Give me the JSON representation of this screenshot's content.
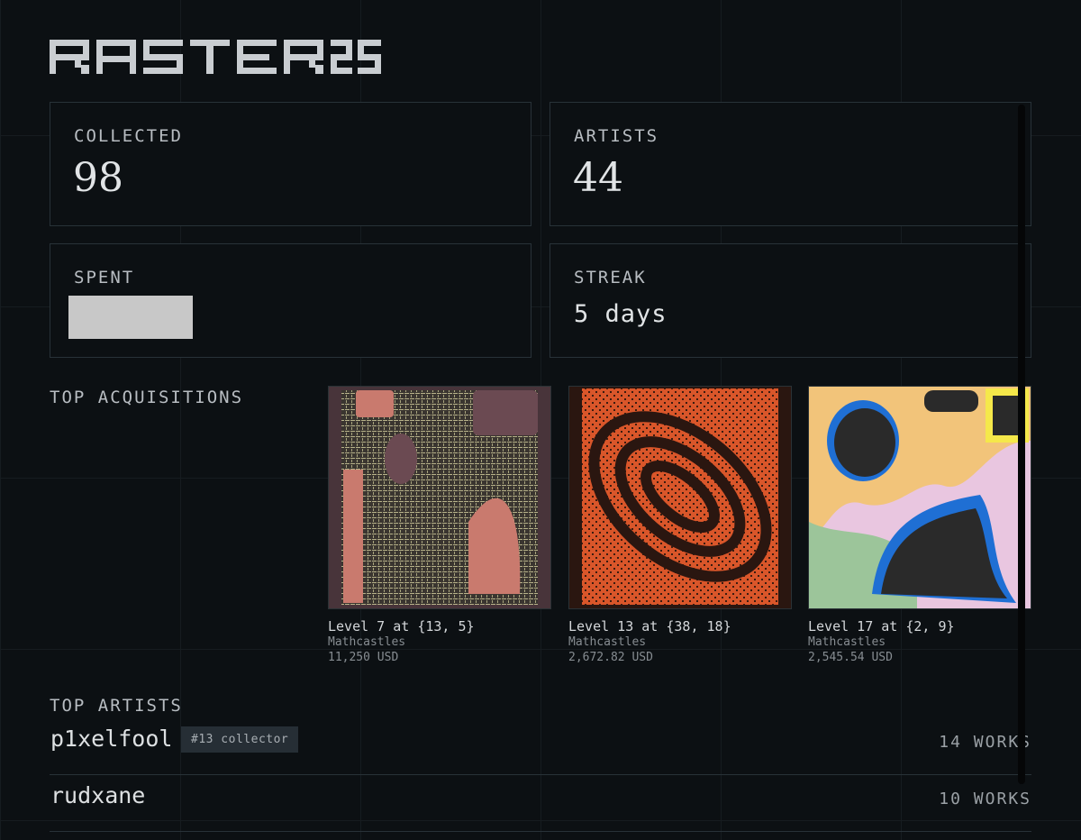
{
  "app": {
    "title": "RASTER 25"
  },
  "stats": {
    "collected": {
      "label": "COLLECTED",
      "value": "98"
    },
    "artists": {
      "label": "ARTISTS",
      "value": "44"
    },
    "spent": {
      "label": "SPENT"
    },
    "streak": {
      "label": "STREAK",
      "value": "5 days"
    }
  },
  "top_acquisitions": {
    "title": "TOP ACQUISITIONS",
    "items": [
      {
        "title": "Level 7 at {13, 5}",
        "artist": "Mathcastles",
        "price": "11,250 USD"
      },
      {
        "title": "Level 13 at {38, 18}",
        "artist": "Mathcastles",
        "price": "2,672.82 USD"
      },
      {
        "title": "Level 17 at {2, 9}",
        "artist": "Mathcastles",
        "price": "2,545.54 USD"
      }
    ]
  },
  "top_artists": {
    "title": "TOP ARTISTS",
    "rows": [
      {
        "name": "p1xelfool",
        "badge": "#13 collector",
        "works": "14 WORKS"
      },
      {
        "name": "rudxane",
        "works": "10 WORKS"
      }
    ]
  },
  "colors": {
    "background": "#0c1013",
    "border": "#283238",
    "badge_bg": "#262e35",
    "redaction": "#c8c8c8"
  }
}
